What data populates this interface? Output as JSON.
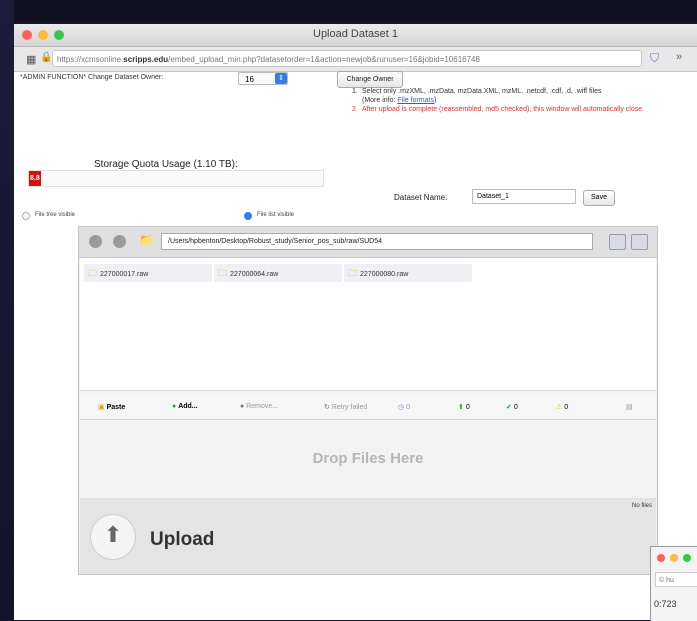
{
  "window": {
    "title": "Upload Dataset 1",
    "url_prefix": "https://xcmsonline.",
    "url_host": "scripps.edu",
    "url_path": "/embed_upload_min.php?datasetorder=1&action=newjob&runuser=16&jobid=10616748"
  },
  "owner": {
    "label": "*ADMIN FUNCTION* Change Dataset Owner:",
    "selected_value": "16",
    "change_button": "Change Owner"
  },
  "instructions": [
    {
      "num": "1.",
      "text": "Select only .mzXML, .mzData, mzData.XML, mzML, .netcdf, .cdf, .d, .wiff files",
      "extra_text": "(More info: ",
      "link": "File formats",
      "extra_close": ")"
    },
    {
      "num": "2.",
      "text": "After upload is complete (reassembled, md5 checked), this window will automatically close."
    }
  ],
  "quota": {
    "title": "Storage Quota Usage (1.10 TB):",
    "value_label": "8.8",
    "fraction": 0.03
  },
  "view_options": {
    "tree": "File tree visible",
    "list": "File list visible"
  },
  "dataset": {
    "label": "Dataset Name:",
    "value": "Dataset_1",
    "save_label": "Save"
  },
  "file_browser": {
    "path": "/Users/hpbenton/Desktop/Robust_study/Senior_pos_sub/raw/SUD54",
    "files": [
      "227000017.raw",
      "227000064.raw",
      "227000080.raw"
    ]
  },
  "actions": {
    "paste": "Paste",
    "add": "Add...",
    "remove": "Remove...",
    "retry": "Retry failed",
    "count_pending": "0",
    "count_uploading": "0",
    "count_done": "0",
    "count_warning": "0"
  },
  "dropzone": {
    "text": "Drop Files Here"
  },
  "footer": {
    "no_files": "No files",
    "upload_label": "Upload"
  },
  "second_window": {
    "url": "© hu",
    "status": "0:723"
  },
  "colors": {
    "accent": "#2f7ef0",
    "error": "#e53030",
    "quota_fill": "#d50f0f"
  }
}
